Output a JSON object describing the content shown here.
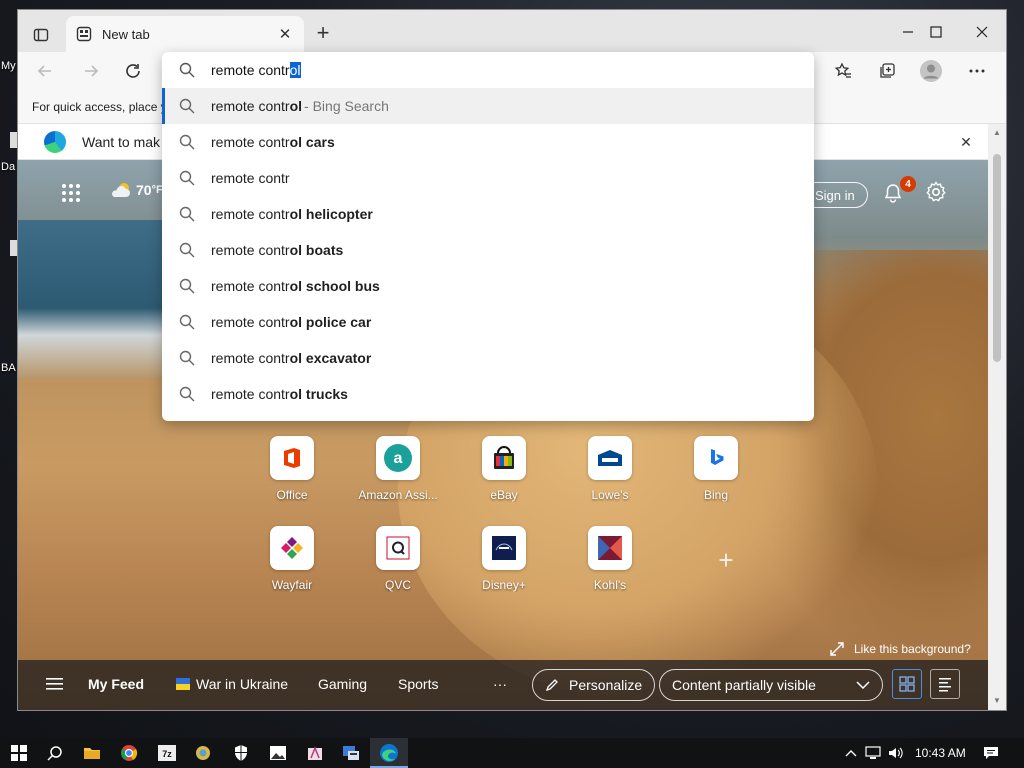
{
  "desktop": {
    "labels": [
      "My",
      "Da",
      "BA"
    ]
  },
  "browser": {
    "tab_title": "New tab",
    "favbar_text": "For quick access, place y",
    "infobar_text": "Want to mak"
  },
  "omnibox": {
    "typed": "remote contr",
    "selected": "ol",
    "suggestions": [
      {
        "prefix": "remote contr",
        "bold": "ol",
        "hint": " - Bing Search"
      },
      {
        "prefix": "remote contr",
        "bold": "ol cars",
        "hint": ""
      },
      {
        "prefix": "remote contr",
        "bold": "",
        "hint": ""
      },
      {
        "prefix": "remote contr",
        "bold": "ol helicopter",
        "hint": ""
      },
      {
        "prefix": "remote contr",
        "bold": "ol boats",
        "hint": ""
      },
      {
        "prefix": "remote contr",
        "bold": "ol school bus",
        "hint": ""
      },
      {
        "prefix": "remote contr",
        "bold": "ol police car",
        "hint": ""
      },
      {
        "prefix": "remote contr",
        "bold": "ol excavator",
        "hint": ""
      },
      {
        "prefix": "remote contr",
        "bold": "ol trucks",
        "hint": ""
      }
    ]
  },
  "ntp": {
    "weather": "70",
    "weather_unit": "°F",
    "signin": "Sign in",
    "notifications": "4",
    "tiles": [
      {
        "label": "Office"
      },
      {
        "label": "Amazon Assi..."
      },
      {
        "label": "eBay"
      },
      {
        "label": "Lowe's"
      },
      {
        "label": "Bing"
      },
      {
        "label": "Wayfair"
      },
      {
        "label": "QVC"
      },
      {
        "label": "Disney+"
      },
      {
        "label": "Kohl's"
      }
    ],
    "like_bg": "Like this background?"
  },
  "feed": {
    "my_feed": "My Feed",
    "war": "War in Ukraine",
    "gaming": "Gaming",
    "sports": "Sports",
    "more": "···",
    "personalize": "Personalize",
    "content_visible": "Content partially visible"
  },
  "taskbar": {
    "clock": "10:43 AM"
  },
  "colors": {
    "accent": "#0b64d0",
    "badge": "#d83b01"
  }
}
